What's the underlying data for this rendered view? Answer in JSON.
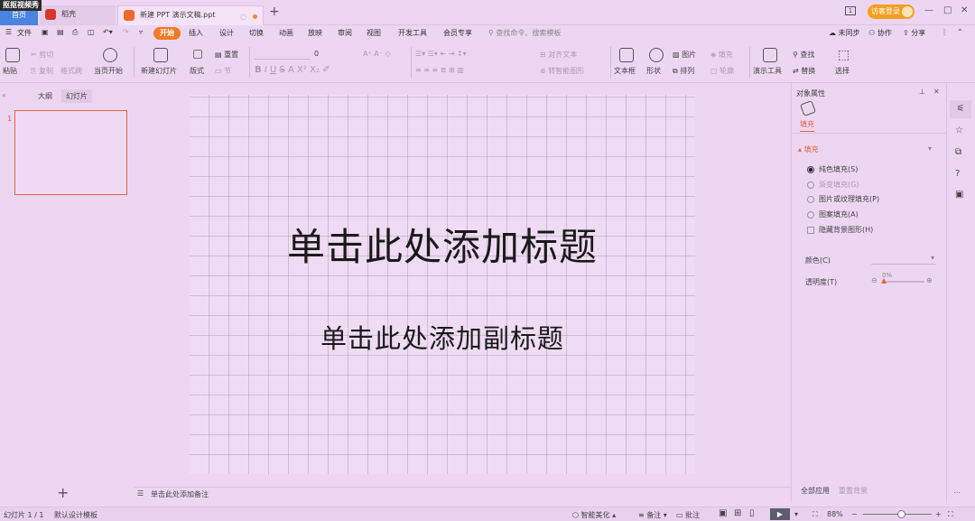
{
  "watermark": "抠抠视频秀",
  "tabs": {
    "home": "首页",
    "dao": "稻壳",
    "doc": "新建 PPT 演示文稿.ppt",
    "new_tab": "+"
  },
  "login": "访客登录",
  "window": {
    "tile": "1",
    "minimize": "—",
    "maximize": "□",
    "close": "✕"
  },
  "menubar": {
    "file": "文件",
    "items": [
      "开始",
      "插入",
      "设计",
      "切换",
      "动画",
      "放映",
      "审阅",
      "视图",
      "开发工具",
      "会员专享"
    ],
    "active": "开始",
    "search_cmd": "查找命令、搜索模板",
    "sync": "未同步",
    "collab": "协作",
    "share": "分享"
  },
  "ribbon": {
    "paste": "粘贴",
    "cut": "剪切",
    "copy": "复制",
    "format_painter": "格式刷",
    "from_start": "当页开始",
    "new_slide": "新建幻灯片",
    "layout": "版式",
    "section": "节",
    "reset": "重置",
    "font_size": "0",
    "align_text": "对齐文本",
    "smart_art": "转智能图形",
    "textbox": "文本框",
    "shape": "形状",
    "arrange": "排列",
    "picture": "图片",
    "fill": "填充",
    "outline": "轮廓",
    "show_tools": "演示工具",
    "find": "查找",
    "replace": "替换",
    "select": "选择"
  },
  "left_panel": {
    "outline": "大纲",
    "slides": "幻灯片",
    "slide_number": "1",
    "add": "+"
  },
  "slide": {
    "title": "单击此处添加标题",
    "subtitle": "单击此处添加副标题"
  },
  "notes": "单击此处添加备注",
  "right_panel": {
    "header": "对象属性",
    "fill_tab": "填充",
    "section_fill": "填充",
    "options": [
      "纯色填充(S)",
      "渐变填充(G)",
      "图片或纹理填充(P)",
      "图案填充(A)"
    ],
    "selected_option": "纯色填充(S)",
    "hide_bg": "隐藏背景图形(H)",
    "color_label": "颜色(C)",
    "transparency_label": "透明度(T)",
    "transparency_value": "0%",
    "apply_all": "全部应用",
    "reset_bg": "重置背景"
  },
  "statusbar": {
    "slide_info": "幻灯片 1 / 1",
    "template": "默认设计模板",
    "beautify": "智能美化",
    "notes": "备注",
    "comments": "批注",
    "zoom": "88%"
  },
  "colors": {
    "accent": "#f07a26",
    "home_tab": "#4a83e0",
    "background": "#edd6f2",
    "login": "#f3a022"
  }
}
